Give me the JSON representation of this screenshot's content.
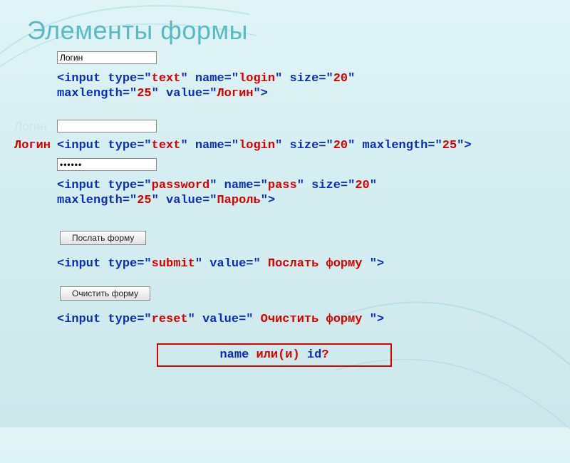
{
  "title": "Элементы формы",
  "login_label": "Логин",
  "password_dots": "••••••",
  "btn_submit": "Послать форму",
  "btn_reset": "Очистить форму",
  "code1": {
    "p1": "<",
    "p2": "input type",
    "p3": "=\"",
    "p4": "text",
    "p5": "\" ",
    "p6": "name",
    "p7": "=\"",
    "p8": "login",
    "p9": "\" ",
    "p10": "size",
    "p11": "=\"",
    "p12": "20",
    "p13": "\"",
    "nl": "\n",
    "p14": "maxlength",
    "p15": "=\"",
    "p16": "25",
    "p17": "\" ",
    "p18": "value",
    "p19": "=\"",
    "p20": "Логин",
    "p21": "\">"
  },
  "code2": {
    "p1": "<",
    "p2": "input type",
    "p3": "=\"",
    "p4": "text",
    "p5": "\" ",
    "p6": "name",
    "p7": "=\"",
    "p8": "login",
    "p9": "\" ",
    "p10": "size",
    "p11": "=\"",
    "p12": "20",
    "p13": "\" ",
    "p14": "maxlength",
    "p15": "=\"",
    "p16": "25",
    "p17": "\">"
  },
  "code3": {
    "p1": "<",
    "p2": "input type",
    "p3": "=\"",
    "p4": "password",
    "p5": "\" ",
    "p6": "name",
    "p7": "=\"",
    "p8": "pass",
    "p9": "\" ",
    "p10": "size",
    "p11": "=\"",
    "p12": "20",
    "p13": "\"",
    "nl": "\n",
    "p14": "maxlength",
    "p15": "=\"",
    "p16": "25",
    "p17": "\" ",
    "p18": "value",
    "p19": "=\"",
    "p20": "Пароль",
    "p21": "\">"
  },
  "code4": {
    "p1": "<",
    "p2": "input type",
    "p3": "=\"",
    "p4": "submit",
    "p5": "\" ",
    "p6": "value",
    "p7": "=\"",
    "p8": " Послать форму ",
    "p9": "\">"
  },
  "code5": {
    "p1": "<",
    "p2": "input type",
    "p3": "=\"",
    "p4": "reset",
    "p5": "\" ",
    "p6": "value",
    "p7": "=\"",
    "p8": " Очистить форму ",
    "p9": "\">"
  },
  "footer": {
    "p1": "name",
    "p2": " или(и) ",
    "p3": "id",
    "p4": "?"
  }
}
